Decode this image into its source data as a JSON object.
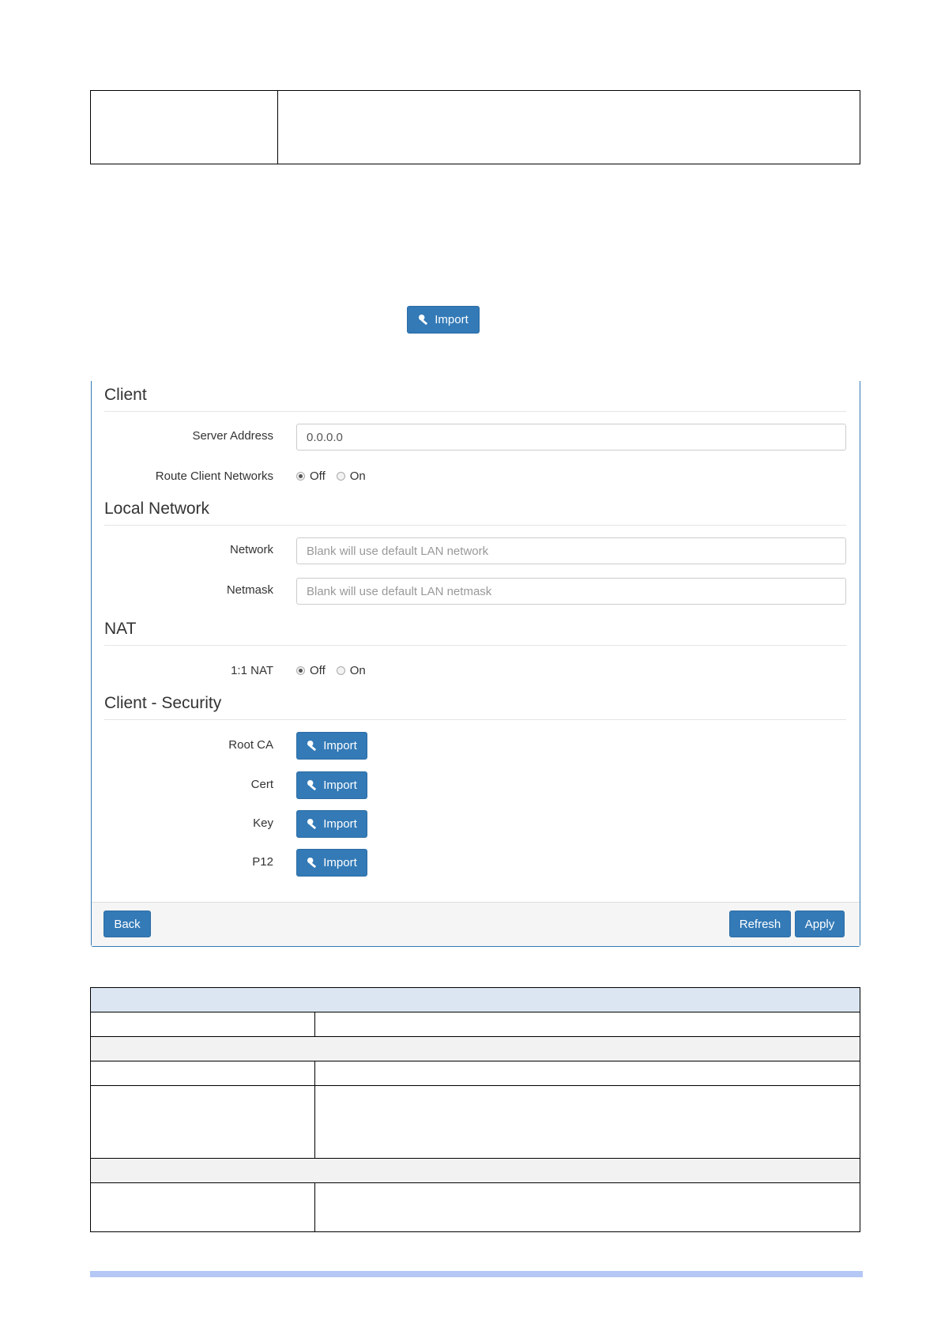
{
  "top_import_button": {
    "label": "Import"
  },
  "client": {
    "title": "Client",
    "server_address": {
      "label": "Server Address",
      "value": "0.0.0.0"
    },
    "route_client_networks": {
      "label": "Route Client Networks",
      "off": "Off",
      "on": "On",
      "selected": "Off"
    }
  },
  "local_network": {
    "title": "Local Network",
    "network": {
      "label": "Network",
      "placeholder": "Blank will use default LAN network"
    },
    "netmask": {
      "label": "Netmask",
      "placeholder": "Blank will use default LAN netmask"
    }
  },
  "nat": {
    "title": "NAT",
    "one_to_one": {
      "label": "1:1 NAT",
      "off": "Off",
      "on": "On",
      "selected": "Off"
    }
  },
  "client_security": {
    "title": "Client - Security",
    "items": [
      {
        "label": "Root CA",
        "button": "Import"
      },
      {
        "label": "Cert",
        "button": "Import"
      },
      {
        "label": "Key",
        "button": "Import"
      },
      {
        "label": "P12",
        "button": "Import"
      }
    ]
  },
  "footer": {
    "back": "Back",
    "refresh": "Refresh",
    "apply": "Apply"
  },
  "icons": {
    "import": "key-icon"
  },
  "colors": {
    "primary": "#337ab7",
    "table_header": "#dce6f2",
    "bottom_bar": "#b4c7f5"
  }
}
